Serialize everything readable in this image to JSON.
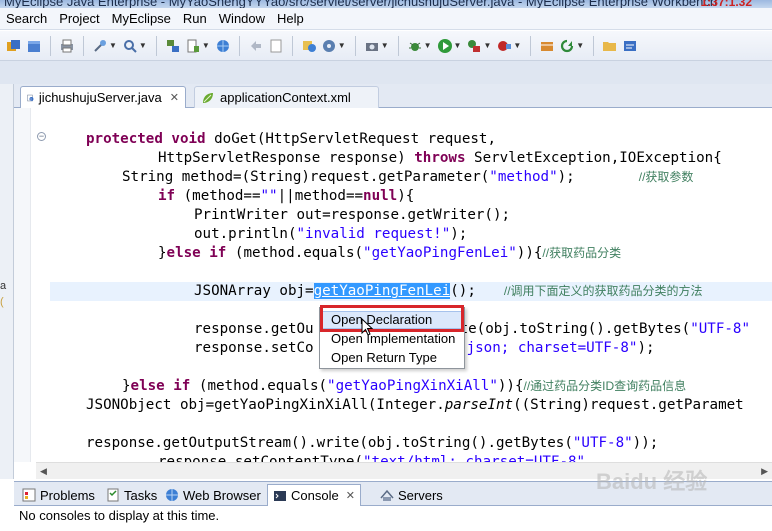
{
  "window": {
    "title": "MyEclipse Java Enterprise - MyYaoShengYYYao/src/servlet/server/jichushujuServer.java - MyEclipse Enterprise Workbench",
    "stamp": "1:37:1.32"
  },
  "menubar": {
    "items": [
      "Search",
      "Project",
      "MyEclipse",
      "Run",
      "Window",
      "Help"
    ]
  },
  "toolbar": {
    "icons": [
      "open-type-icon",
      "package-icon",
      "print-icon",
      "debug-config-icon",
      "search-icon",
      "server-icon",
      "deploy-icon",
      "globe-icon",
      "previous-edit-icon",
      "new-file-icon",
      "web-globe-icon",
      "camera-icon",
      "debug-icon",
      "run-icon",
      "external-tools-icon",
      "stop-icon",
      "plugin-icon",
      "refresh-icon",
      "open-folder-icon",
      "task-icon"
    ]
  },
  "left_strip": {
    "fragment1": "a",
    "fragment2": "("
  },
  "editor": {
    "tabs": [
      {
        "label": "jichushujuServer.java",
        "active": true,
        "close": "✕"
      },
      {
        "label": "applicationContext.xml",
        "active": false
      }
    ]
  },
  "code": {
    "line1": [
      "protected",
      " ",
      "void",
      " doGet(HttpServletRequest request,"
    ],
    "line2": [
      "HttpServletResponse response) ",
      "throws",
      " ServletException,IOException{"
    ],
    "line3": [
      "String method=(String)request.getParameter(",
      "\"method\"",
      ");",
      "//获取参数"
    ],
    "line4": [
      "if",
      " (method==",
      "\"\"",
      "||method==",
      "null",
      "){"
    ],
    "line5": "PrintWriter out=response.getWriter();",
    "line6": [
      "out.println(",
      "\"invalid request!\"",
      ");"
    ],
    "line7": [
      "}",
      "else",
      " ",
      "if",
      " (method.equals(",
      "\"getYaoPingFenLei\"",
      ")){",
      "//获取药品分类"
    ],
    "line8": [
      "JSONArray obj=",
      "getYaoPingFenLei",
      "();",
      "//调用下面定义的获取药品分类的方法"
    ],
    "line9": [
      "response.getOu",
      "te(obj.toString().getBytes(",
      "\"UTF-8\""
    ],
    "line10": [
      "response.setCo",
      "json; charset=UTF-8\"",
      ");"
    ],
    "line11": [
      "}",
      "else",
      " ",
      "if",
      " (method.equals(",
      "\"getYaoPingXinXiAll\"",
      ")){",
      "//通过药品分类ID查询药品信息"
    ],
    "line12": [
      "JSONObject obj=getYaoPingXinXiAll(Integer.",
      "parseInt",
      "((String)request.getParamet"
    ],
    "line13": [
      "response.getOutputStream().write(obj.toString().getBytes(",
      "\"UTF-8\"",
      "));"
    ],
    "line14": [
      "response.setContentType(",
      "\"text/html; charset=UTF-8\""
    ]
  },
  "context_menu": {
    "items": [
      "Open Declaration",
      "Open Implementation",
      "Open Return Type"
    ]
  },
  "bottom_panel": {
    "tabs": [
      {
        "label": "Problems",
        "icon": "problems-icon"
      },
      {
        "label": "Tasks",
        "icon": "tasks-icon"
      },
      {
        "label": "Web Browser",
        "icon": "web-browser-icon"
      },
      {
        "label": "Console",
        "icon": "console-icon",
        "active": true,
        "close": "✕"
      },
      {
        "label": "Servers",
        "icon": "servers-icon"
      }
    ],
    "console_message": "No consoles to display at this time."
  },
  "watermark": "Baidu 经验",
  "colors": {
    "keyword": "#7f0055",
    "string": "#2a00ff",
    "comment": "#3f7f5f",
    "selection": "#3399ff",
    "highlight_box": "#d8262a"
  }
}
